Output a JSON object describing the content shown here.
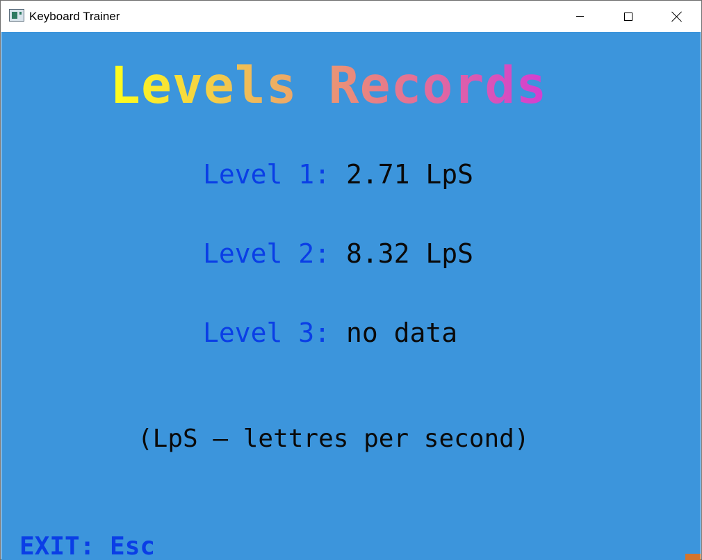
{
  "window": {
    "title": "Keyboard Trainer",
    "icon": "app-window-icon",
    "controls": {
      "minimize_icon": "minimize-icon",
      "maximize_icon": "maximize-icon",
      "close_icon": "close-icon"
    }
  },
  "screen": {
    "heading": "Levels Records",
    "heading_colors": [
      "#ffff1a",
      "#eeb55e",
      "#e88183",
      "#d23ed2"
    ],
    "records": [
      {
        "label": "Level 1:",
        "value": "2.71 LpS"
      },
      {
        "label": "Level 2:",
        "value": "8.32 LpS"
      },
      {
        "label": "Level 3:",
        "value": "no data"
      }
    ],
    "footnote": "(LpS — lettres per second)",
    "exit_hint": "EXIT: Esc"
  },
  "colors": {
    "background": "#3c95dc",
    "label": "#0a3ee6",
    "value": "#0a0a0a",
    "accent_corner": "#d4742c"
  }
}
